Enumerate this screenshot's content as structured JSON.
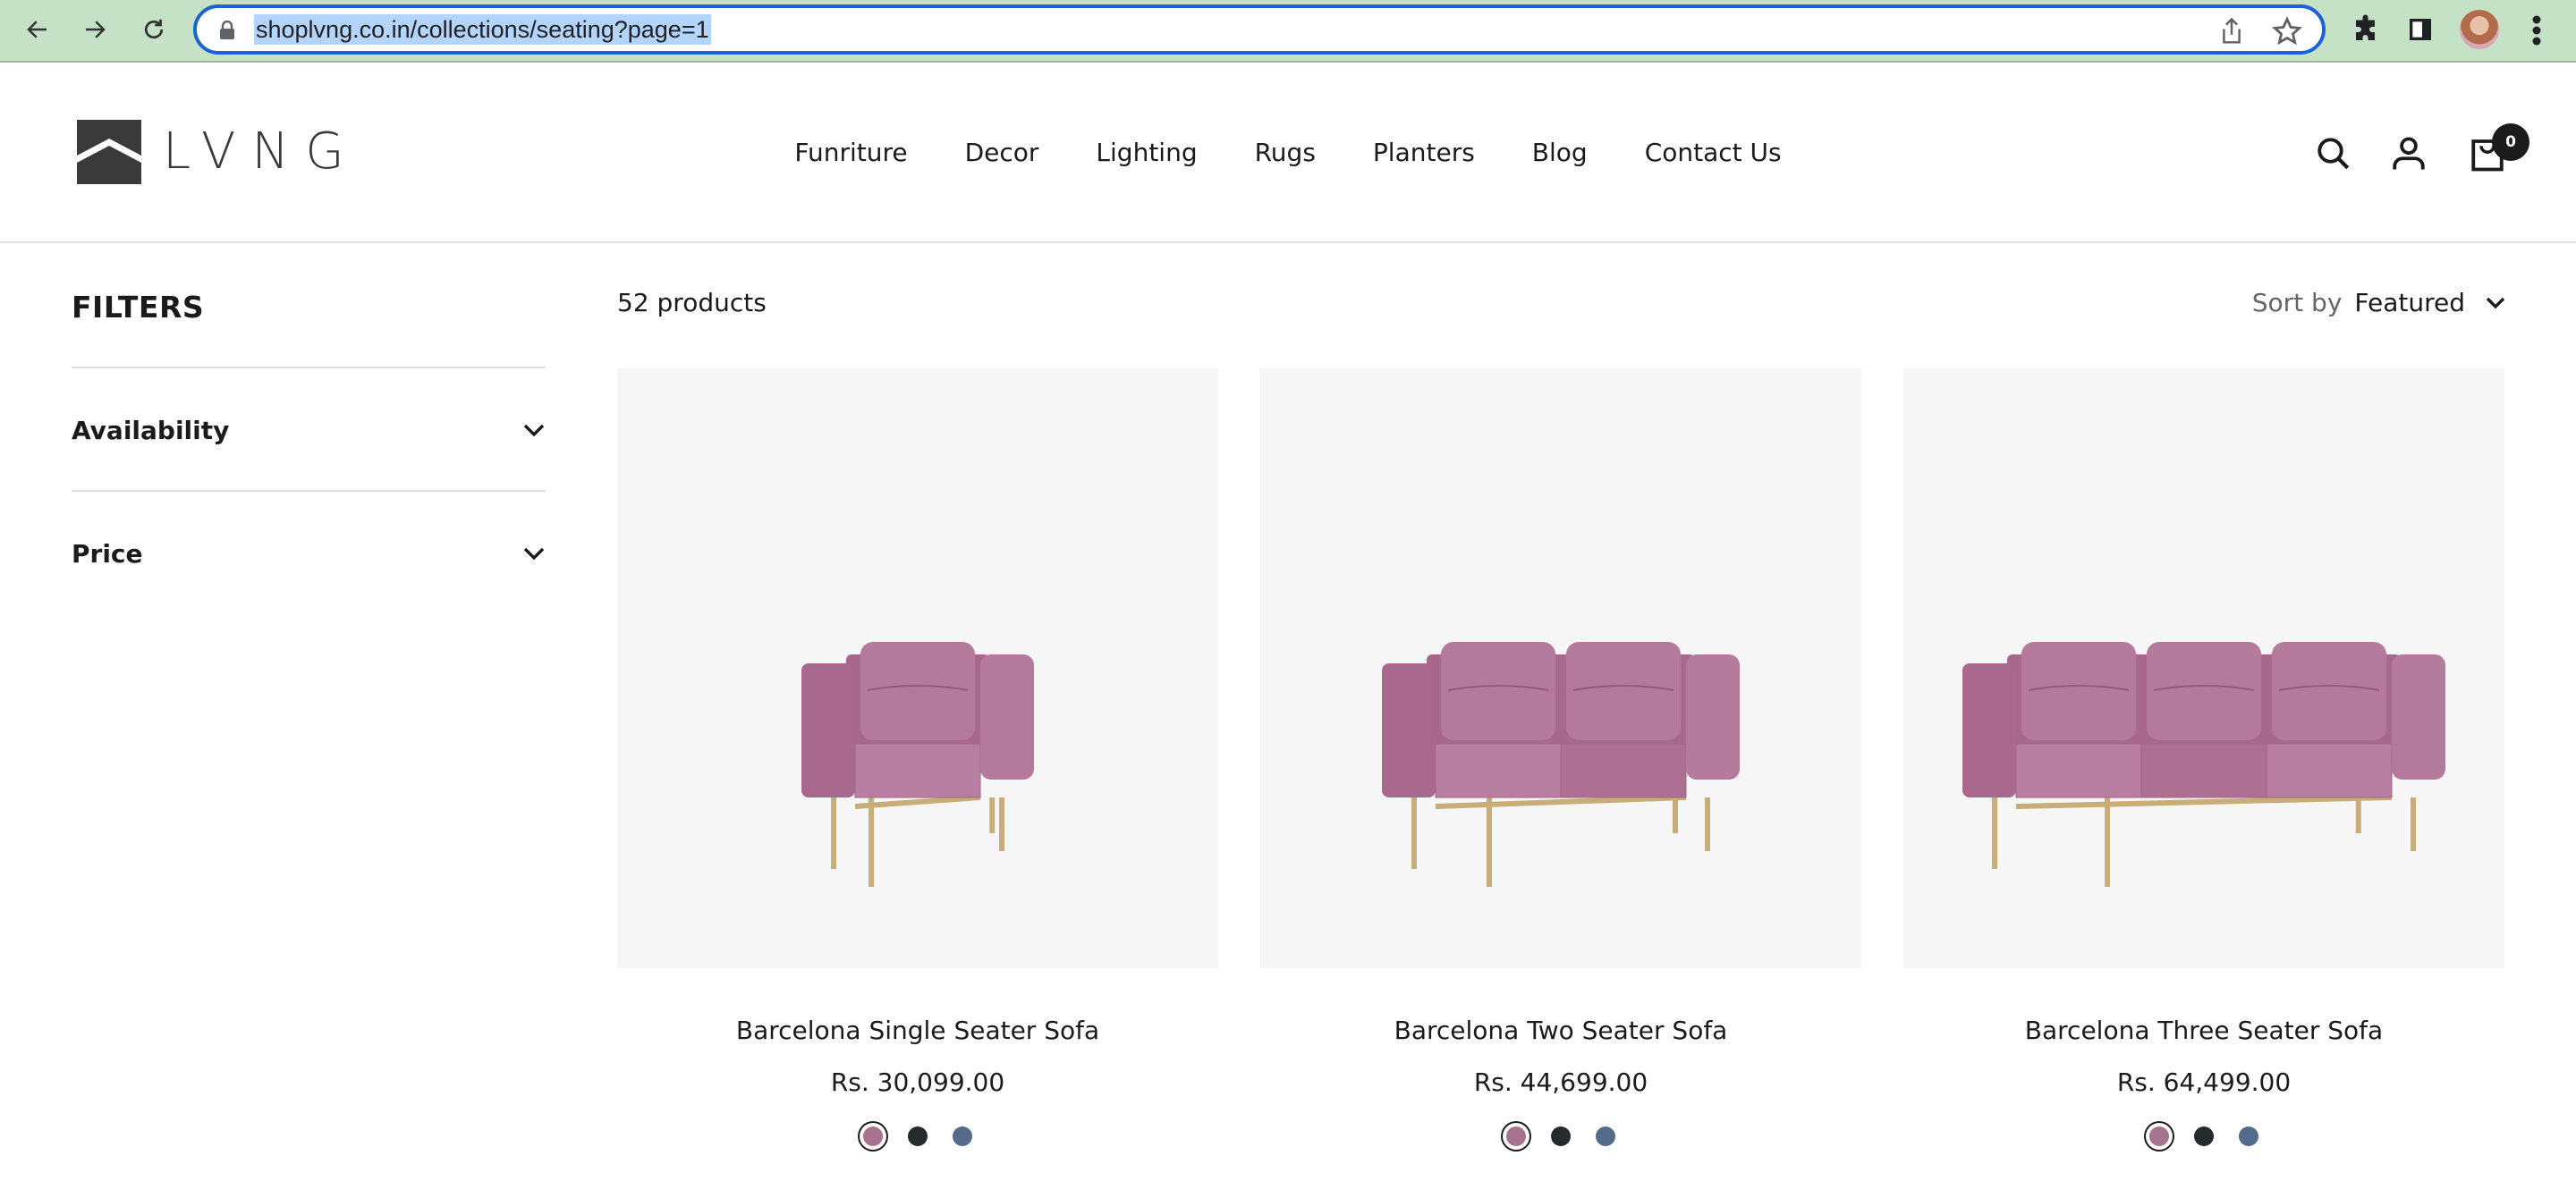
{
  "browser": {
    "url": "shoplvng.co.in/collections/seating?page=1",
    "icons": [
      "back-arrow-icon",
      "forward-arrow-icon",
      "reload-icon",
      "lock-icon",
      "share-icon",
      "bookmark-star-icon",
      "extensions-puzzle-icon",
      "side-panel-icon",
      "profile-avatar",
      "more-menu-icon"
    ]
  },
  "header": {
    "logo_text": "LVNG",
    "nav": [
      "Funriture",
      "Decor",
      "Lighting",
      "Rugs",
      "Planters",
      "Blog",
      "Contact Us"
    ],
    "cart_count": "0"
  },
  "sidebar": {
    "title": "FILTERS",
    "filters": [
      {
        "label": "Availability"
      },
      {
        "label": "Price"
      }
    ]
  },
  "main": {
    "product_count": "52 products",
    "sort_label": "Sort by",
    "sort_value": "Featured",
    "products": [
      {
        "title": "Barcelona Single Seater Sofa",
        "price": "Rs. 30,099.00",
        "seats": 1,
        "swatches": [
          {
            "name": "pink",
            "color": "#a6728d",
            "active": true
          },
          {
            "name": "black",
            "color": "#252b2d",
            "active": false
          },
          {
            "name": "blue",
            "color": "#546b8a",
            "active": false
          }
        ]
      },
      {
        "title": "Barcelona Two Seater Sofa",
        "price": "Rs. 44,699.00",
        "seats": 2,
        "swatches": [
          {
            "name": "pink",
            "color": "#a6728d",
            "active": true
          },
          {
            "name": "black",
            "color": "#252b2d",
            "active": false
          },
          {
            "name": "blue",
            "color": "#546b8a",
            "active": false
          }
        ]
      },
      {
        "title": "Barcelona Three Seater Sofa",
        "price": "Rs. 64,499.00",
        "seats": 3,
        "swatches": [
          {
            "name": "pink",
            "color": "#a6728d",
            "active": true
          },
          {
            "name": "black",
            "color": "#252b2d",
            "active": false
          },
          {
            "name": "blue",
            "color": "#546b8a",
            "active": false
          }
        ]
      }
    ]
  },
  "colors": {
    "chrome_bg": "#c5e1c6",
    "url_focus": "#1a63d6",
    "text": "#1c1b1b",
    "image_bg": "#f6f6f6",
    "sofa_pink": "#b87ea1",
    "leg_gold": "#c9ad78"
  }
}
